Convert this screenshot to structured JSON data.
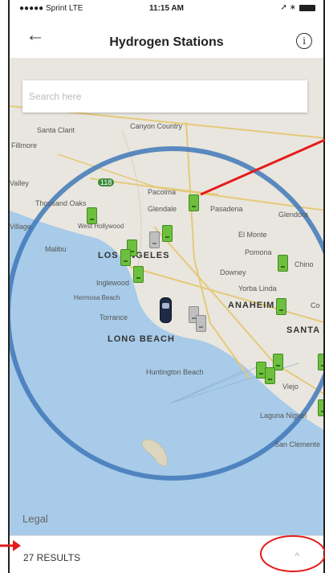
{
  "status_bar": {
    "carrier": "●●●●● Sprint  LTE",
    "time": "11:15 AM",
    "signal_icons": "➚ ∗"
  },
  "nav": {
    "back_icon": "←",
    "title": "Hydrogen Stations",
    "info_icon": "i"
  },
  "search": {
    "placeholder": "Search here"
  },
  "map": {
    "labels": {
      "santa_clarita": "Santa Clarit",
      "canyon_country": "Canyon Country",
      "fillmore": "Fillmore",
      "valley": "Valley",
      "highway": "118",
      "thousand_oaks": "Thousand Oaks",
      "pacoima": "Pacoima",
      "glendale": "Glendale",
      "pasadena": "Pasadena",
      "glendora": "Glendora",
      "village": "Village",
      "west_hollywood": "West Hollywood",
      "malibu": "Malibu",
      "el_monte": "El Monte",
      "pomona": "Pomona",
      "los_angeles": "LOS ANGELES",
      "chino": "Chino",
      "inglewood": "Inglewood",
      "downey": "Downey",
      "hermosa": "Hermosa Beach",
      "yorba_linda": "Yorba Linda",
      "torrance": "Torrance",
      "anaheim": "ANAHEIM",
      "co": "Co",
      "long_beach": "LONG BEACH",
      "santa_a": "SANTA A",
      "huntington": "Huntington Beach",
      "viejo": "Viejo",
      "laguna": "Laguna Niguel",
      "san_clemente": "San Clemente"
    },
    "legal": "Legal"
  },
  "footer": {
    "results": "27 RESULTS",
    "chevron": "^"
  },
  "colors": {
    "radius_circle": "#3f78b8",
    "water": "#a7cbe8",
    "pin_green": "#6fbf3f",
    "annotation": "#e51b1b"
  }
}
